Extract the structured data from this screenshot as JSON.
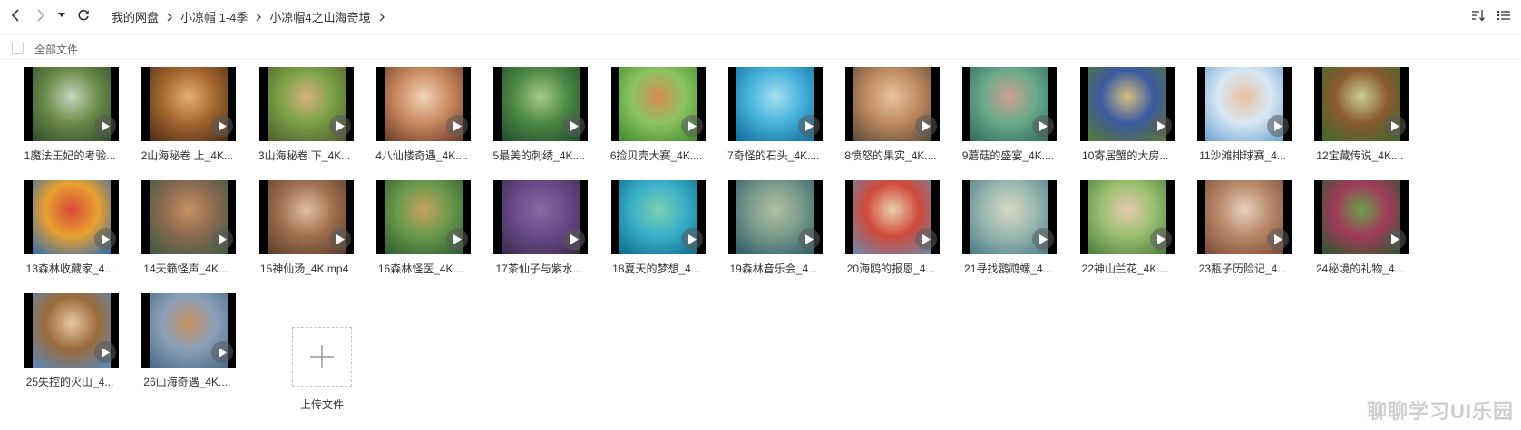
{
  "toolbar": {
    "back_icon": "chevron-left-icon",
    "forward_icon": "chevron-right-icon",
    "history_icon": "caret-down-icon",
    "refresh_icon": "refresh-icon",
    "breadcrumb": [
      "我的网盘",
      "小凉帽 1-4季",
      "小凉帽4之山海奇境"
    ],
    "sort_icon": "sort-icon",
    "view_icon": "list-view-icon"
  },
  "filter": {
    "all_files_label": "全部文件"
  },
  "files": [
    {
      "name": "1魔法王妃的考验...",
      "colors": [
        "#2f4a2a",
        "#6b8c4a",
        "#c9d6c0"
      ]
    },
    {
      "name": "2山海秘卷 上_4K...",
      "colors": [
        "#4a2a18",
        "#a5682e",
        "#e2b070"
      ]
    },
    {
      "name": "3山海秘卷 下_4K...",
      "colors": [
        "#4f5a30",
        "#7aa245",
        "#d7b080"
      ]
    },
    {
      "name": "4八仙楼奇遇_4K....",
      "colors": [
        "#6a3a28",
        "#c98a60",
        "#f0d3b8"
      ]
    },
    {
      "name": "5最美的刺绣_4K....",
      "colors": [
        "#1f4a2a",
        "#4e8a45",
        "#a9c98a"
      ]
    },
    {
      "name": "6捡贝壳大赛_4K....",
      "colors": [
        "#3e8a2e",
        "#8cc460",
        "#d98a50"
      ]
    },
    {
      "name": "7奇怪的石头_4K....",
      "colors": [
        "#0e6a9a",
        "#47b2dc",
        "#a8e0f0"
      ]
    },
    {
      "name": "8愤怒的果实_4K....",
      "colors": [
        "#5a4838",
        "#c08b60",
        "#e8c4a0"
      ]
    },
    {
      "name": "9蘑菇的盛宴_4K....",
      "colors": [
        "#2e6a5a",
        "#6aaa8a",
        "#d0a090"
      ]
    },
    {
      "name": "10寄居蟹的大房...",
      "colors": [
        "#5a7a30",
        "#3a5aa0",
        "#d8c080"
      ]
    },
    {
      "name": "11沙滩排球赛_4...",
      "colors": [
        "#6aa0d0",
        "#d8e8f4",
        "#e8c0a0"
      ]
    },
    {
      "name": "12宝藏传说_4K....",
      "colors": [
        "#3a6a2a",
        "#8a5a30",
        "#c8d090"
      ]
    },
    {
      "name": "13森林收藏家_4...",
      "colors": [
        "#2a6ab0",
        "#e8a030",
        "#d84a3a"
      ]
    },
    {
      "name": "14天籁怪声_4K....",
      "colors": [
        "#3a5a40",
        "#8a6a50",
        "#c89060"
      ]
    },
    {
      "name": "15神仙汤_4K.mp4",
      "colors": [
        "#5a3a28",
        "#a07050",
        "#e0c0a0"
      ]
    },
    {
      "name": "16森林怪医_4K....",
      "colors": [
        "#2a5a30",
        "#6a9a4a",
        "#c8a060"
      ]
    },
    {
      "name": "17茶仙子与紫水...",
      "colors": [
        "#3a2a4a",
        "#6a4a8a",
        "#8a6aa0"
      ]
    },
    {
      "name": "18夏天的梦想_4...",
      "colors": [
        "#0a6a8a",
        "#3ab0c8",
        "#7ad0b0"
      ]
    },
    {
      "name": "19森林音乐会_4...",
      "colors": [
        "#2a5a6a",
        "#7a9a8a",
        "#b0c0a0"
      ]
    },
    {
      "name": "20海鸥的报恩_4...",
      "colors": [
        "#6a8ab0",
        "#d04a3a",
        "#e8d0b0"
      ]
    },
    {
      "name": "21寻找鹦鹉螺_4...",
      "colors": [
        "#4a7a8a",
        "#9ab8b0",
        "#d8d8c0"
      ]
    },
    {
      "name": "22神山兰花_4K....",
      "colors": [
        "#4a7a3a",
        "#9ac070",
        "#e8c8b0"
      ]
    },
    {
      "name": "23瓶子历险记_4...",
      "colors": [
        "#7a4a38",
        "#b88868",
        "#e8d0c0"
      ]
    },
    {
      "name": "24秘境的礼物_4...",
      "colors": [
        "#2a5a2a",
        "#a03a5a",
        "#6aa04a"
      ]
    },
    {
      "name": "25失控的火山_4...",
      "colors": [
        "#5a8ac0",
        "#9a6a3a",
        "#e8c8a0"
      ]
    },
    {
      "name": "26山海奇遇_4K....",
      "colors": [
        "#4a6a8a",
        "#8aa0b8",
        "#c89060"
      ]
    }
  ],
  "upload": {
    "icon": "plus-icon",
    "label": "上传文件"
  },
  "watermark": "聊聊学习UI乐园",
  "play_icon": "play-icon"
}
